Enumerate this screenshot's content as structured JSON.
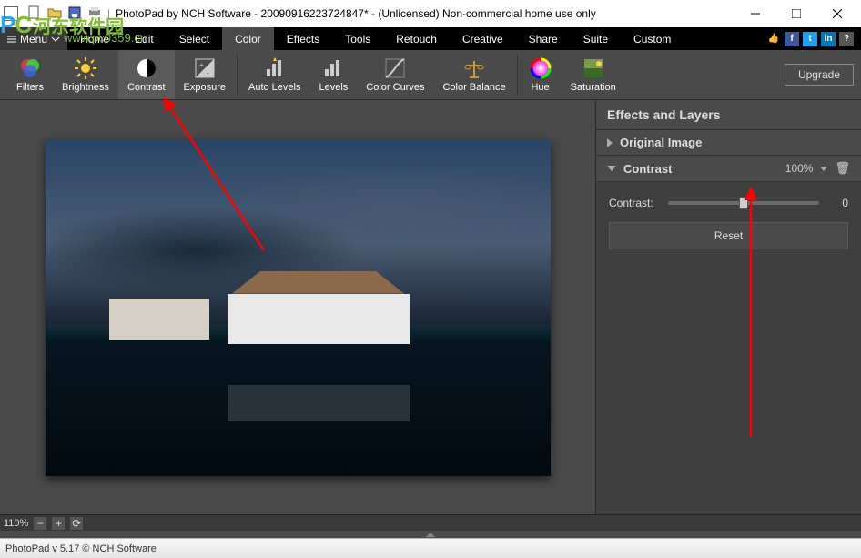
{
  "window": {
    "title": "PhotoPad by NCH Software - 20090916223724847* - (Unlicensed) Non-commercial home use only",
    "minimize": "–",
    "maximize": "☐",
    "close": "✕"
  },
  "watermark": {
    "b": "P",
    "c": "C",
    "cn": "河东软件园",
    "url": "www.pc0359.cn"
  },
  "menu": {
    "menu_label": "Menu",
    "items": [
      "Home",
      "Edit",
      "Select",
      "Color",
      "Effects",
      "Tools",
      "Retouch",
      "Creative",
      "Share",
      "Suite",
      "Custom"
    ],
    "active_index": 3
  },
  "toolbar": {
    "tools": [
      {
        "id": "filters",
        "label": "Filters"
      },
      {
        "id": "brightness",
        "label": "Brightness"
      },
      {
        "id": "contrast",
        "label": "Contrast"
      },
      {
        "id": "exposure",
        "label": "Exposure"
      },
      {
        "id": "auto-levels",
        "label": "Auto Levels"
      },
      {
        "id": "levels",
        "label": "Levels"
      },
      {
        "id": "color-curves",
        "label": "Color Curves"
      },
      {
        "id": "color-balance",
        "label": "Color Balance"
      },
      {
        "id": "hue",
        "label": "Hue"
      },
      {
        "id": "saturation",
        "label": "Saturation"
      }
    ],
    "upgrade": "Upgrade"
  },
  "panel": {
    "title": "Effects and Layers",
    "original": "Original Image",
    "contrast_layer": "Contrast",
    "layer_opacity": "100%",
    "slider_label": "Contrast:",
    "slider_value": "0",
    "reset": "Reset"
  },
  "zoom": {
    "value": "110%"
  },
  "status": {
    "text": "PhotoPad v 5.17  © NCH Software"
  }
}
